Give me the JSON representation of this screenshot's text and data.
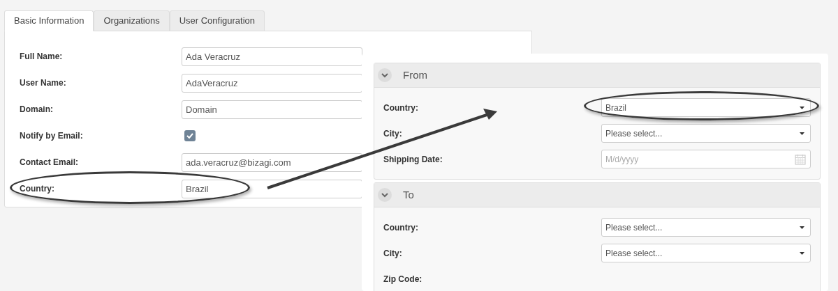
{
  "tabs": [
    {
      "label": "Basic Information",
      "selected": true
    },
    {
      "label": "Organizations",
      "selected": false
    },
    {
      "label": "User Configuration",
      "selected": false
    }
  ],
  "user_form": {
    "rows": [
      {
        "label": "Full Name:",
        "kind": "text",
        "value": "Ada Veracruz"
      },
      {
        "label": "User Name:",
        "kind": "text",
        "value": "AdaVeracruz"
      },
      {
        "label": "Domain:",
        "kind": "text",
        "value": "Domain"
      },
      {
        "label": "Notify by Email:",
        "kind": "checkbox",
        "checked": true
      },
      {
        "label": "Contact Email:",
        "kind": "text",
        "value": "ada.veracruz@bizagi.com"
      },
      {
        "label": "Country:",
        "kind": "text",
        "value": "Brazil"
      }
    ]
  },
  "shipping_form": {
    "sections": [
      {
        "title": "From",
        "expanded": true,
        "fields": [
          {
            "label": "Country:",
            "kind": "select",
            "value": "Brazil"
          },
          {
            "label": "City:",
            "kind": "select",
            "placeholder": "Please select..."
          },
          {
            "label": "Shipping Date:",
            "kind": "date",
            "placeholder": "M/d/yyyy"
          }
        ]
      },
      {
        "title": "To",
        "expanded": true,
        "fields": [
          {
            "label": "Country:",
            "kind": "select",
            "placeholder": "Please select..."
          },
          {
            "label": "City:",
            "kind": "select",
            "placeholder": "Please select..."
          },
          {
            "label": "Zip Code:",
            "kind": "none"
          }
        ]
      }
    ]
  }
}
